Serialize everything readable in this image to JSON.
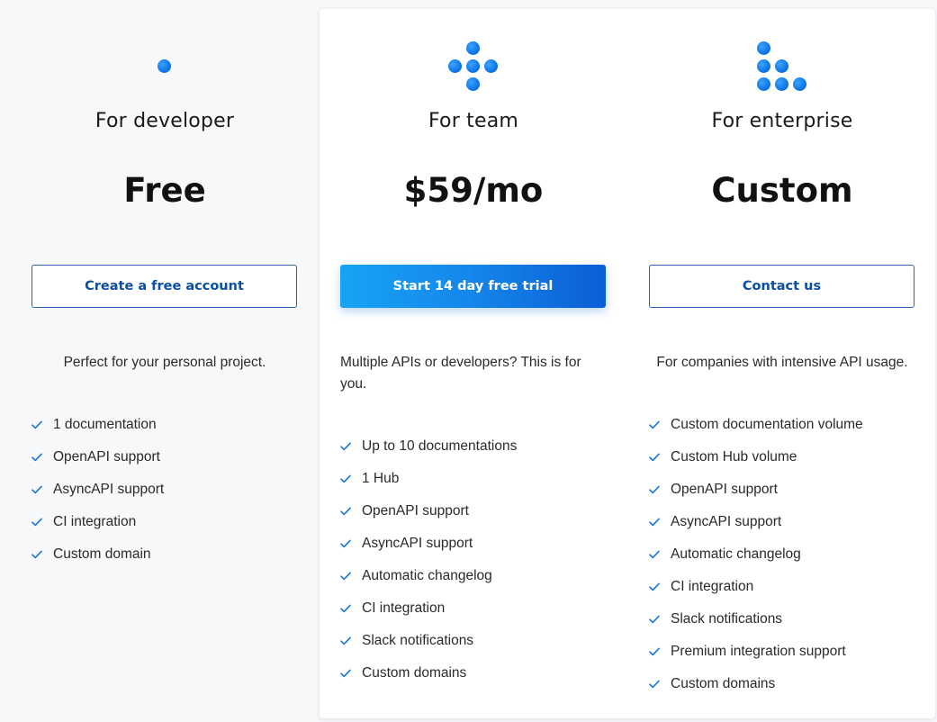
{
  "colors": {
    "accent": "#1585ea",
    "button_outline": "#2b63b8",
    "button_text": "#0b4ea2",
    "check": "#1a73d9",
    "card_background": "#ffffff",
    "page_background": "#f7f8fa"
  },
  "plans": [
    {
      "id": "developer",
      "icon": "single-dot-icon",
      "name": "For developer",
      "price": "Free",
      "button_label": "Create a free account",
      "button_style": "outline",
      "description": "Perfect for your personal project.",
      "features": [
        "1 documentation",
        "OpenAPI support",
        "AsyncAPI support",
        "CI integration",
        "Custom domain"
      ]
    },
    {
      "id": "team",
      "icon": "dot-cross-icon",
      "name": "For team",
      "price": "$59/mo",
      "button_label": "Start 14 day free trial",
      "button_style": "solid",
      "description": "Multiple APIs or developers? This is for you.",
      "features": [
        "Up to 10 documentations",
        "1 Hub",
        "OpenAPI support",
        "AsyncAPI support",
        "Automatic changelog",
        "CI integration",
        "Slack notifications",
        "Custom domains"
      ]
    },
    {
      "id": "enterprise",
      "icon": "dot-staircase-icon",
      "name": "For enterprise",
      "price": "Custom",
      "button_label": "Contact us",
      "button_style": "outline",
      "description": "For companies with intensive API usage.",
      "features": [
        "Custom documentation volume",
        "Custom Hub volume",
        "OpenAPI support",
        "AsyncAPI support",
        "Automatic changelog",
        "CI integration",
        "Slack notifications",
        "Premium integration support",
        "Custom domains"
      ]
    }
  ]
}
